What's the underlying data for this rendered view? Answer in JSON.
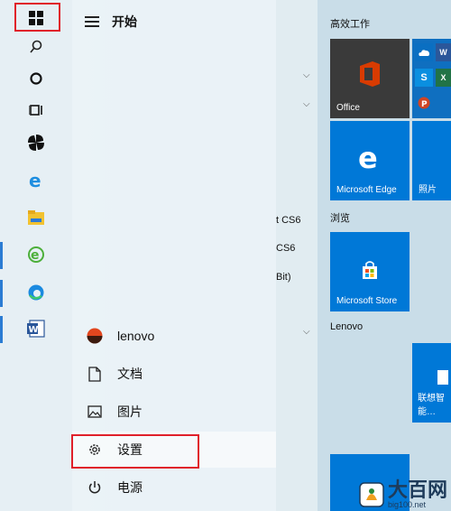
{
  "start_menu": {
    "title": "开始",
    "items": [
      {
        "label": "lenovo",
        "icon": "user-avatar"
      },
      {
        "label": "文档",
        "icon": "document-icon"
      },
      {
        "label": "图片",
        "icon": "picture-icon"
      },
      {
        "label": "设置",
        "icon": "gear-icon"
      },
      {
        "label": "电源",
        "icon": "power-icon"
      }
    ]
  },
  "app_list_fragments": [
    "t CS6",
    "CS6",
    "Bit)"
  ],
  "tiles": {
    "group1_title": "高效工作",
    "office_label": "Office",
    "edge_label": "Microsoft Edge",
    "photos_label": "照片",
    "group2_title": "浏览",
    "store_label": "Microsoft Store",
    "group3_title": "Lenovo",
    "lenovo_tile_label": "联想智能…"
  },
  "watermark": {
    "name": "大百网",
    "url": "big100.net"
  },
  "colors": {
    "accent": "#0078d7",
    "highlight": "#e0202a"
  }
}
